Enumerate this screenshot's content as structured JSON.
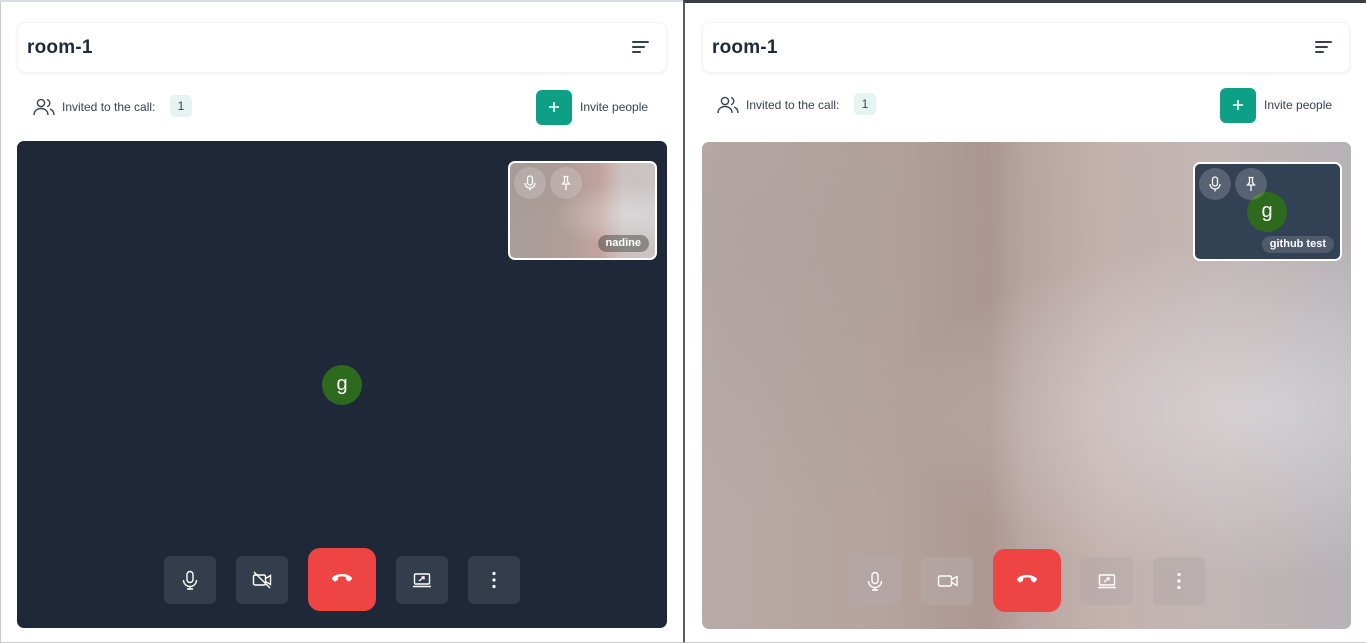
{
  "panes": [
    {
      "room": {
        "title": "room-1"
      },
      "invite": {
        "invited_label": "Invited to the call:",
        "count": "1",
        "invite_label": "Invite people"
      },
      "main_avatar_letter": "g",
      "thumbnail": {
        "name": "nadine",
        "avatar_letter": ""
      },
      "camera_state": "off"
    },
    {
      "room": {
        "title": "room-1"
      },
      "invite": {
        "invited_label": "Invited to the call:",
        "count": "1",
        "invite_label": "Invite people"
      },
      "main_avatar_letter": "",
      "thumbnail": {
        "name": "github test",
        "avatar_letter": "g"
      },
      "camera_state": "on"
    }
  ],
  "icons": [
    "people-icon",
    "menu-icon",
    "plus-icon",
    "mic-icon",
    "pin-icon",
    "video-off-icon",
    "video-icon",
    "phone-hangup-icon",
    "screen-share-icon",
    "more-vertical-icon"
  ],
  "colors": {
    "accent": "#0e9f87",
    "hangup": "#ef4444",
    "stage_dark": "#1f2839",
    "avatar": "#2d6a1d"
  }
}
